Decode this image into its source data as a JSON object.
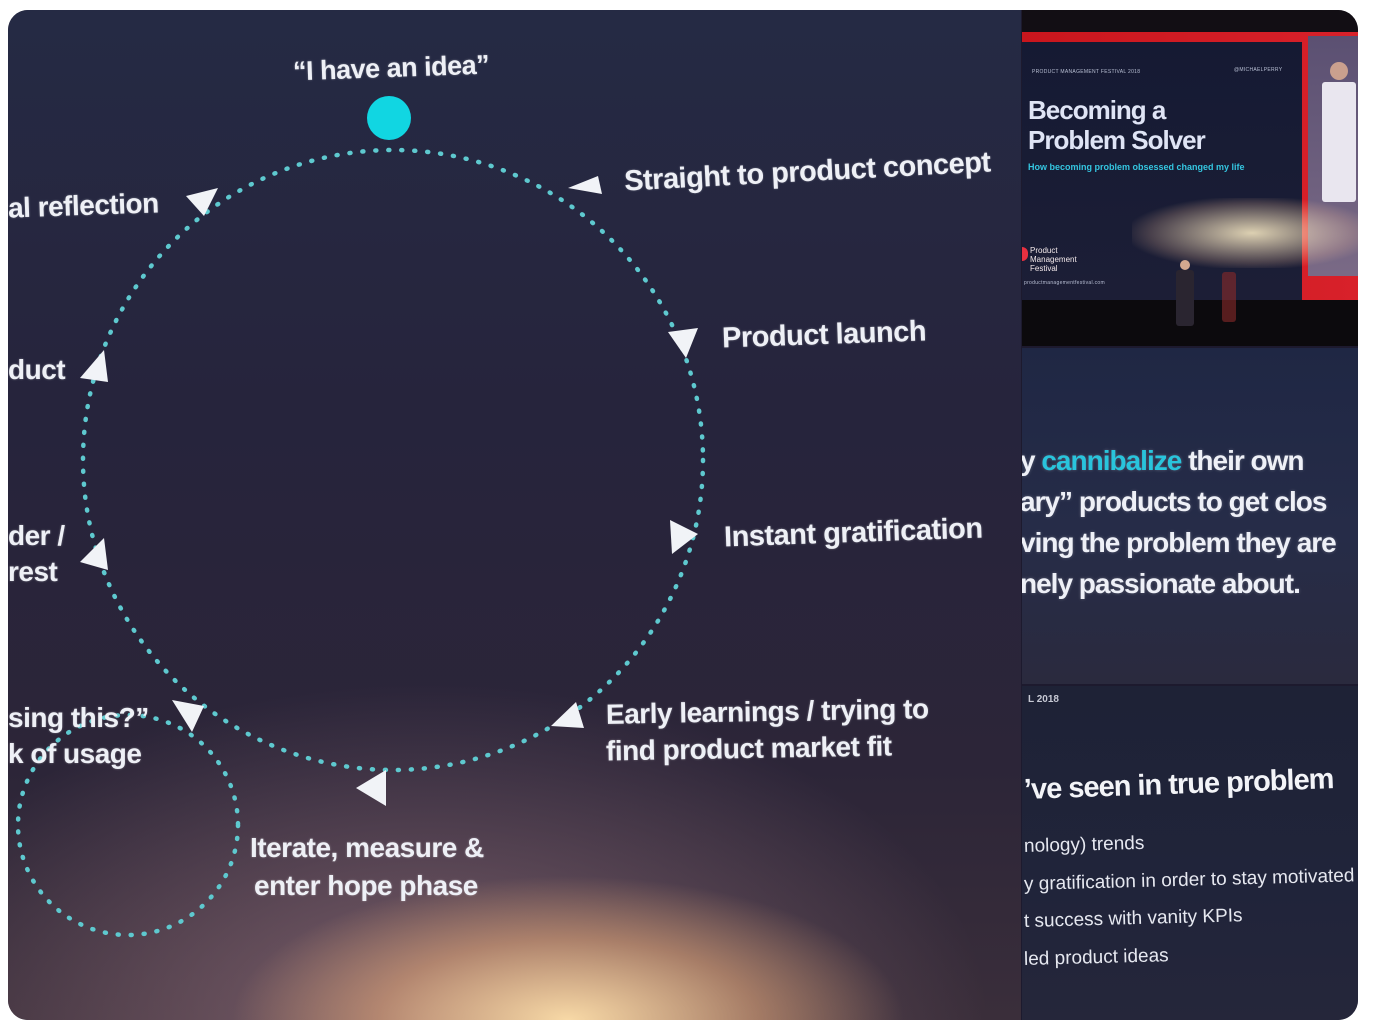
{
  "main_photo": {
    "cycle_labels": {
      "idea": "“I have an idea”",
      "straight_to_concept": "Straight to product concept",
      "product_launch": "Product launch",
      "instant_gratification": "Instant gratification",
      "early_learnings_1": "Early learnings / trying to",
      "early_learnings_2": "find product market fit",
      "iterate_1": "Iterate, measure &",
      "iterate_2": "enter hope phase",
      "reflection": "al reflection",
      "product": "duct",
      "wonder_1": "der /",
      "wonder_2": "rest",
      "using_1": "sing this?”",
      "using_2": "k of usage"
    },
    "colors": {
      "dot": "#11d6e2",
      "dotted_line": "#5ec9cf",
      "label": "#eef0f6"
    }
  },
  "stage_photo": {
    "festival_top": "PRODUCT MANAGEMENT FESTIVAL 2018",
    "handle": "@MICHAELPERRY",
    "title_line1": "Becoming a",
    "title_line2": "Problem Solver",
    "subtitle": "How becoming problem obsessed changed my life",
    "festival_line1": "Product",
    "festival_line2": "Management",
    "festival_line3": "Festival",
    "website": "productmanagementfestival.com"
  },
  "quote_photo": {
    "line1_pre": "y ",
    "line1_accent": "cannibalize",
    "line1_post": " their own",
    "line2": "ary” products to get clos",
    "line3": "ving the problem they are",
    "line4": "nely passionate about."
  },
  "list_photo": {
    "top_label": "L 2018",
    "heading": "’ve seen in true problem",
    "items": [
      "nology) trends",
      "y gratification in order to stay motivated",
      "t success with vanity KPIs",
      "led product ideas"
    ]
  }
}
